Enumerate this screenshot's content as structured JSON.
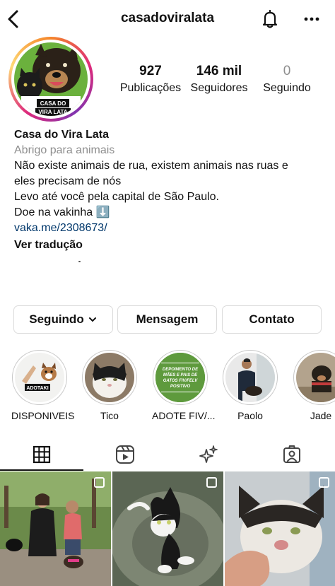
{
  "header": {
    "username": "casadoviralata"
  },
  "avatar": {
    "line1": "CASA DO",
    "line2": "VIRA LATA"
  },
  "stats": [
    {
      "value": "927",
      "label": "Publicações"
    },
    {
      "value": "146 mil",
      "label": "Seguidores"
    },
    {
      "value": "0",
      "label": "Seguindo"
    }
  ],
  "bio": {
    "name": "Casa do Vira Lata",
    "category": "Abrigo para animais",
    "line1": "Não existe animais de rua, existem animais nas ruas e",
    "line2": "eles precisam de nós",
    "line3": "Levo até você pela capital de São Paulo.",
    "line4": "Doe na vakinha ⬇️",
    "link": "vaka.me/2308673/",
    "translate": "Ver tradução"
  },
  "buttons": {
    "following": "Seguindo",
    "message": "Mensagem",
    "contact": "Contato"
  },
  "highlights": [
    {
      "label": "DISPONIVEIS",
      "badge": "ADOTAKI"
    },
    {
      "label": "Tico"
    },
    {
      "label": "ADOTE FIV/...",
      "badge": "DEPOIMENTO DE MÃES E PAIS DE GATOS FIV/FELV POSITIVO"
    },
    {
      "label": "Paolo"
    },
    {
      "label": "Jade"
    }
  ],
  "tabs": [
    "grid-icon",
    "reels-icon",
    "sparkles-icon",
    "tagged-icon"
  ],
  "colors": {
    "link": "#00376b",
    "secondary_text": "#8e8e8e",
    "border": "#dbdbdb",
    "green_badge": "#5e9a3d"
  }
}
